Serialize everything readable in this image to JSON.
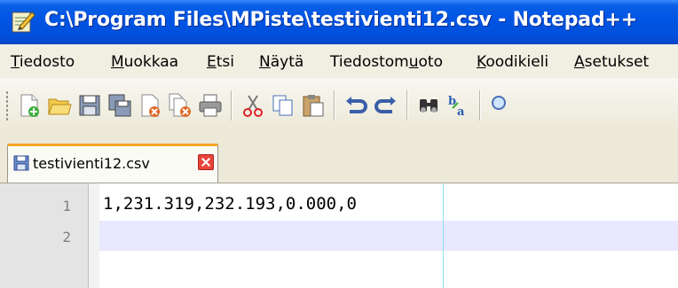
{
  "window": {
    "title": "C:\\Program Files\\MPiste\\testivienti12.csv - Notepad++"
  },
  "menu": [
    {
      "pre": "",
      "acc": "T",
      "post": "iedosto"
    },
    {
      "pre": "",
      "acc": "M",
      "post": "uokkaa"
    },
    {
      "pre": "",
      "acc": "E",
      "post": "tsi"
    },
    {
      "pre": "",
      "acc": "N",
      "post": "äytä"
    },
    {
      "pre": "Tiedostom",
      "acc": "u",
      "post": "oto"
    },
    {
      "pre": "",
      "acc": "K",
      "post": "oodikieli"
    },
    {
      "pre": "",
      "acc": "A",
      "post": "setukset"
    }
  ],
  "toolbar": {
    "icons": [
      "new-file-icon",
      "open-file-icon",
      "save-icon",
      "save-all-icon",
      "close-icon",
      "close-all-icon",
      "print-icon",
      "cut-icon",
      "copy-icon",
      "paste-icon",
      "undo-icon",
      "redo-icon",
      "find-icon",
      "replace-icon",
      "zoom-icon"
    ]
  },
  "tabs": [
    {
      "label": "testivienti12.csv",
      "active": true
    }
  ],
  "editor": {
    "lines": [
      {
        "number": "1",
        "text": "1,231.319,232.193,0.000,0"
      },
      {
        "number": "2",
        "text": ""
      }
    ],
    "current_line": 2
  },
  "colors": {
    "titlebar": "#0054e3",
    "current_line_bg": "#e8e8ff",
    "edge_line": "#8fe0f0",
    "tab_accent": "#f5a623"
  }
}
